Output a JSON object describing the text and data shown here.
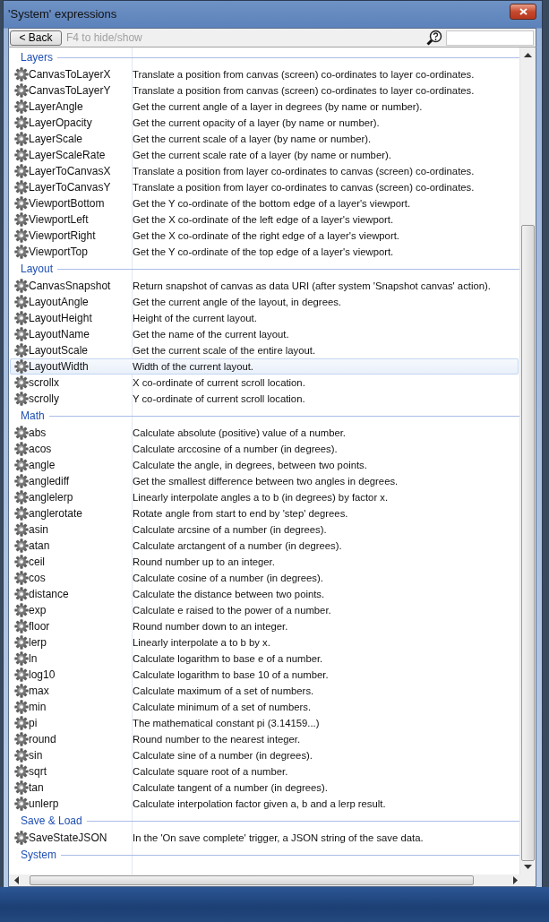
{
  "window": {
    "title": "'System' expressions"
  },
  "toolbar": {
    "back_button": "< Back",
    "hint": "F4 to hide/show"
  },
  "groups": [
    {
      "name": "Layers",
      "items": [
        {
          "name": "CanvasToLayerX",
          "description": "Translate a position from canvas (screen) co-ordinates to layer co-ordinates.",
          "selected": false
        },
        {
          "name": "CanvasToLayerY",
          "description": "Translate a position from canvas (screen) co-ordinates to layer co-ordinates.",
          "selected": false
        },
        {
          "name": "LayerAngle",
          "description": "Get the current angle of a layer in degrees (by name or number).",
          "selected": false
        },
        {
          "name": "LayerOpacity",
          "description": "Get the current opacity of a layer (by name or number).",
          "selected": false
        },
        {
          "name": "LayerScale",
          "description": "Get the current scale of a layer (by name or number).",
          "selected": false
        },
        {
          "name": "LayerScaleRate",
          "description": "Get the current scale rate of a layer (by name or number).",
          "selected": false
        },
        {
          "name": "LayerToCanvasX",
          "description": "Translate a position from layer co-ordinates to canvas (screen) co-ordinates.",
          "selected": false
        },
        {
          "name": "LayerToCanvasY",
          "description": "Translate a position from layer co-ordinates to canvas (screen) co-ordinates.",
          "selected": false
        },
        {
          "name": "ViewportBottom",
          "description": "Get the Y co-ordinate of the bottom edge of a layer's viewport.",
          "selected": false
        },
        {
          "name": "ViewportLeft",
          "description": "Get the X co-ordinate of the left edge of a layer's viewport.",
          "selected": false
        },
        {
          "name": "ViewportRight",
          "description": "Get the X co-ordinate of the right edge of a layer's viewport.",
          "selected": false
        },
        {
          "name": "ViewportTop",
          "description": "Get the Y co-ordinate of the top edge of a layer's viewport.",
          "selected": false
        }
      ]
    },
    {
      "name": "Layout",
      "items": [
        {
          "name": "CanvasSnapshot",
          "description": "Return snapshot of canvas as data URI (after system 'Snapshot canvas' action).",
          "selected": false
        },
        {
          "name": "LayoutAngle",
          "description": "Get the current angle of the layout, in degrees.",
          "selected": false
        },
        {
          "name": "LayoutHeight",
          "description": "Height of the current layout.",
          "selected": false
        },
        {
          "name": "LayoutName",
          "description": "Get the name of the current layout.",
          "selected": false
        },
        {
          "name": "LayoutScale",
          "description": "Get the current scale of the entire layout.",
          "selected": false
        },
        {
          "name": "LayoutWidth",
          "description": "Width of the current layout.",
          "selected": true
        },
        {
          "name": "scrollx",
          "description": "X co-ordinate of current scroll location.",
          "selected": false
        },
        {
          "name": "scrolly",
          "description": "Y co-ordinate of current scroll location.",
          "selected": false
        }
      ]
    },
    {
      "name": "Math",
      "items": [
        {
          "name": "abs",
          "description": "Calculate absolute (positive) value of a number.",
          "selected": false
        },
        {
          "name": "acos",
          "description": "Calculate arccosine of a number (in degrees).",
          "selected": false
        },
        {
          "name": "angle",
          "description": "Calculate the angle, in degrees, between two points.",
          "selected": false
        },
        {
          "name": "anglediff",
          "description": "Get the smallest difference between two angles in degrees.",
          "selected": false
        },
        {
          "name": "anglelerp",
          "description": "Linearly interpolate angles a to b (in degrees) by factor x.",
          "selected": false
        },
        {
          "name": "anglerotate",
          "description": "Rotate angle from start to end by 'step' degrees.",
          "selected": false
        },
        {
          "name": "asin",
          "description": "Calculate arcsine of a number (in degrees).",
          "selected": false
        },
        {
          "name": "atan",
          "description": "Calculate arctangent of a number (in degrees).",
          "selected": false
        },
        {
          "name": "ceil",
          "description": "Round number up to an integer.",
          "selected": false
        },
        {
          "name": "cos",
          "description": "Calculate cosine of a number (in degrees).",
          "selected": false
        },
        {
          "name": "distance",
          "description": "Calculate the distance between two points.",
          "selected": false
        },
        {
          "name": "exp",
          "description": "Calculate e raised to the power of a number.",
          "selected": false
        },
        {
          "name": "floor",
          "description": "Round number down to an integer.",
          "selected": false
        },
        {
          "name": "lerp",
          "description": "Linearly interpolate a to b by x.",
          "selected": false
        },
        {
          "name": "ln",
          "description": "Calculate logarithm to base e of a number.",
          "selected": false
        },
        {
          "name": "log10",
          "description": "Calculate logarithm to base 10 of a number.",
          "selected": false
        },
        {
          "name": "max",
          "description": "Calculate maximum of a set of numbers.",
          "selected": false
        },
        {
          "name": "min",
          "description": "Calculate minimum of a set of numbers.",
          "selected": false
        },
        {
          "name": "pi",
          "description": "The mathematical constant pi (3.14159...)",
          "selected": false
        },
        {
          "name": "round",
          "description": "Round number to the nearest integer.",
          "selected": false
        },
        {
          "name": "sin",
          "description": "Calculate sine of a number (in degrees).",
          "selected": false
        },
        {
          "name": "sqrt",
          "description": "Calculate square root of a number.",
          "selected": false
        },
        {
          "name": "tan",
          "description": "Calculate tangent of a number (in degrees).",
          "selected": false
        },
        {
          "name": "unlerp",
          "description": "Calculate interpolation factor given a, b and a lerp result.",
          "selected": false
        }
      ]
    },
    {
      "name": "Save & Load",
      "items": [
        {
          "name": "SaveStateJSON",
          "description": "In the 'On save complete' trigger, a JSON string of the save data.",
          "selected": false
        }
      ]
    },
    {
      "name": "System"
    }
  ]
}
